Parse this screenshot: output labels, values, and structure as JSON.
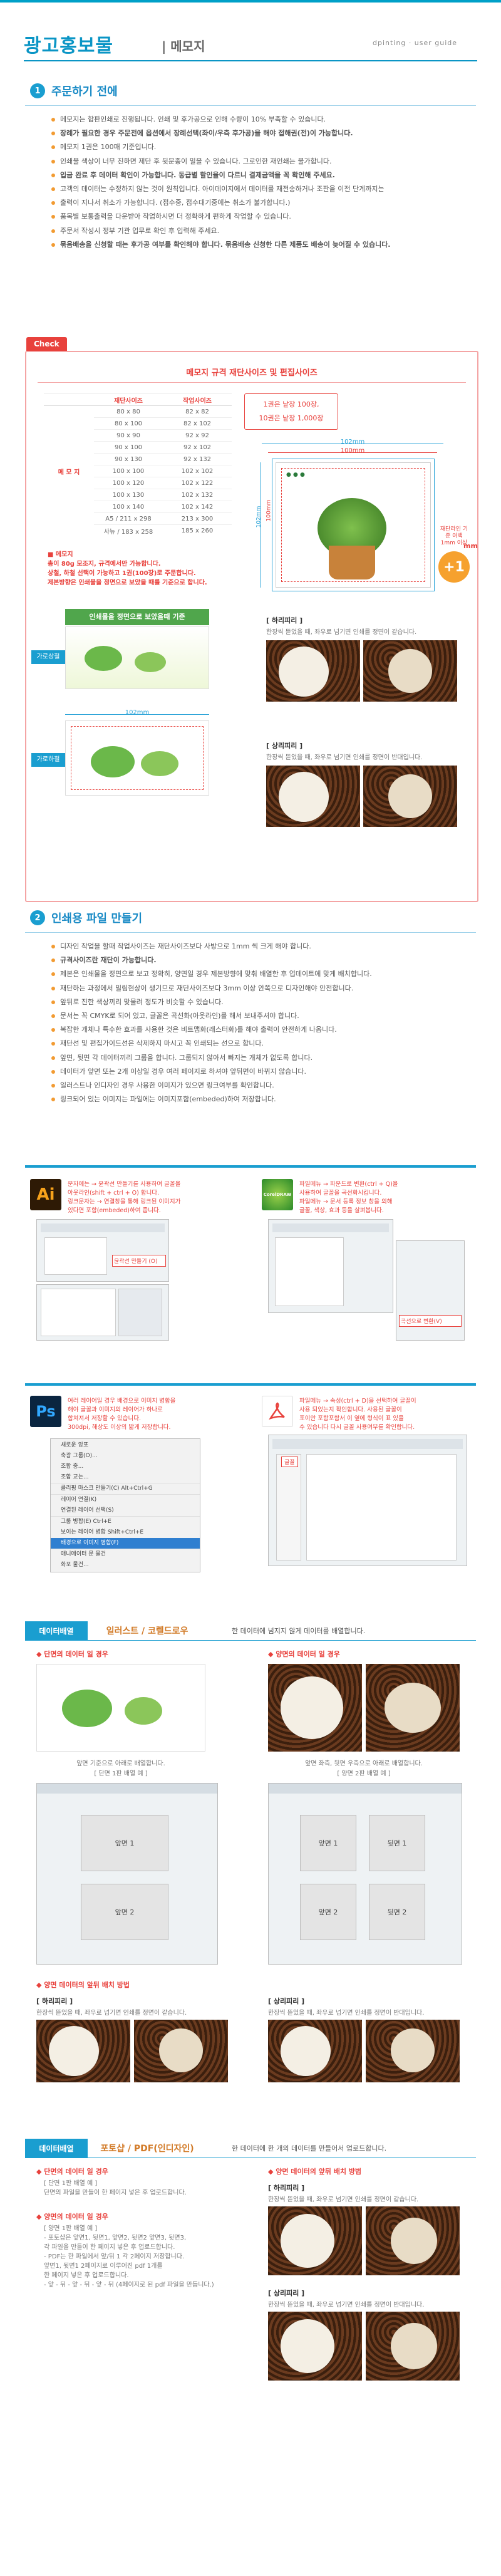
{
  "header": {
    "title": "광고홍보물",
    "subtitle": "| 메모지",
    "brand": "dpinting · user guide"
  },
  "section1": {
    "number": "1",
    "title": "주문하기 전에",
    "bullets": [
      "메모지는 합판인쇄로 진행됩니다. 인쇄 및 후가공으로 인해 수량이 10% 부족할 수 있습니다.",
      "장례가 필요한 경우 주문전에 옵션에서 장례선택(좌이/우측 후가공)을 해야 접해권(전)이 가능합니다.",
      "메모지 1권은 100매 기준입니다.",
      "인쇄물 색상이 너무 진하면 제단 후 뒷문종이 밀을 수 있습니다. 그로인한 재인쇄는 불가합니다.",
      "입금 완료 후 데이터 확인이 가능합니다. 동급별 할인율이 다르니 결제금액을 꼭 확인해 주세요.",
      "고객의 데이터는 수정하지 않는 것이 원칙입니다. 아이데이지에서 데이터를 재전송하거나 조판을 이전 단계까지는",
      "출력이 지나서 취소가 가능합니다. (접수중, 접수대기중에는 취소가 불가합니다.)",
      "품목별 보통출력을 다운받아 작업하시면 더 정확하게 편하게 작업할 수 있습니다.",
      "주문서 작성시 정부 기관 업무로 확인 후 입력해 주세요.",
      "묶음배송을 신청할 때는 후가공 여부를 확인해야 합니다. 묶음배송 신청한 다른 제품도 배송이 늦어질 수 있습니다."
    ]
  },
  "check_box": {
    "tab": "Check",
    "heading": "메모지 규격 재단사이즈 및 편집사이즈",
    "table": {
      "headers": [
        "",
        "재단사이즈",
        "작업사이즈"
      ],
      "product": "메 모 지",
      "rows": [
        [
          "80 x 80",
          "82 x 82"
        ],
        [
          "80 x 100",
          "82 x 102"
        ],
        [
          "90 x 90",
          "92 x 92"
        ],
        [
          "90 x 100",
          "92 x 102"
        ],
        [
          "90 x 130",
          "92 x 132"
        ],
        [
          "100 x 100",
          "102 x 102"
        ],
        [
          "100 x 120",
          "102 x 122"
        ],
        [
          "100 x 130",
          "102 x 132"
        ],
        [
          "100 x 140",
          "102 x 142"
        ],
        [
          "A5 / 211 x 298",
          "213 x 300"
        ],
        [
          "사뉴 / 183 x 258",
          "185 x 260"
        ]
      ]
    },
    "qty_lines": [
      "1권은 낱장 100장,",
      "10권은 낱장 1,000장"
    ],
    "dim_top_outer": "102mm",
    "dim_top_inner": "100mm",
    "dim_side_outer": "102mm",
    "dim_side_inner": "100mm",
    "bleed_note": "재단라인 기준 여백 1mm 이상",
    "plus_one": "+1",
    "mm": "mm",
    "memo_note_title": "■ 메모지",
    "memo_note_lines": [
      "총이 80g 모조지, 규격에서만 가능합니다.",
      "상철, 하철 선택이 가능하고 1권(100장)로 주문합니다.",
      "제본방향은 인쇄물을 정면으로 보았을 때를 기준으로 합니다."
    ],
    "green_bar": "인쇄물을 정면으로 보았을때 기준",
    "tag_vertical": "가로상철",
    "tag_horizontal": "가로하철",
    "dim_card_top": "102mm",
    "dim_card_top2": "100mm",
    "left_label": "[ 하리피리 ]",
    "left_text": "한장씩 뜯었을 때, 좌우로 넘기면 인쇄를 정면이 같습니다.",
    "right_label": "[ 상리피리 ]",
    "right_text": "한장씩 뜯었을 때, 좌우로 넘기면 인쇄를 정면이 반대입니다."
  },
  "section2": {
    "number": "2",
    "title": "인쇄용 파일 만들기",
    "bullets": [
      "디자인 작업을 할때 작업사이즈는 재단사이즈보다 사방으로 1mm 씩 크게 해야 합니다.",
      "규격사이즈란 재단이 가능합니다.",
      "제본은 인쇄물을 정면으로 보고 정확히, 양면일 경우 제본방향에 맞춰 배열한 후 업데이트에 맞게 배치합니다.",
      "재단하는 과정에서 밀림현상이 생기므로 재단사이즈보다 3mm 이상 안쪽으로 디자인해야 안전합니다.",
      "앞뒤로 진한 색상끼리 맞물려 정도가 비슷할 수 있습니다.",
      "문서는 꼭 CMYK로 되어 있고, 글꼴은 곡선화(아웃라인)를 해서 보내주셔야 합니다.",
      "복잡한 개체나 특수한 효과를 사용한 것은 비트맵화(래스터화)를 해야 출력이 안전하게 나옵니다.",
      "재단선 및 편집가이드선은 삭제하지 마시고 꼭 인쇄되는 선으로 합니다.",
      "앞면, 뒷면 각 데이터끼리 그룹을 합니다. 그룹되지 않아서 빠지는 개체가 없도록 합니다.",
      "데이터가 앞면 또는 2개 이상일 경우 여러 페이지로 하셔야 앞뒤면이 바뀌지 않습니다.",
      "일러스트나 인디자인 경우 사용한 이미지가 있으면 링크여부를 확인합니다.",
      "링크되어 있는 이미지는 파일에는 이미지포함(embeded)하여 저장합니다."
    ]
  },
  "software": {
    "ai_lines": [
      "문자에는 → 윤곽선 만들기를 사용하여 글꼴을",
      "아웃라인(shift + ctrl + O) 합니다.",
      "링크문자는 → 연결창을 통해 링크된 이미지가",
      "있다면 포함(embeded)하여 줍니다."
    ],
    "ai_badge": "Ai",
    "cd_badge": "CorelDRAW",
    "cd_lines": [
      "파일메뉴 → 파운드로 변환(ctrl + Q)을",
      "사용하여 글꼴을 곡선화시킵니다.",
      "파일메뉴 → 문서 등록 정보 창을 의해",
      "글꼴, 색상, 효과 등을 살펴봅니다."
    ],
    "ai_menu_hint": "윤곽선 만들기 (O)",
    "cd_menu_hint": "곡선으로 변환(V)",
    "ps_badge": "Ps",
    "ps_lines": [
      "여러 레이어일 경우 배경으로 이미지 병합을",
      "해야 글꼴과 이미지의 레이어가 하나로",
      "합쳐져서 저장할 수 있습니다.",
      "300dpi, 해상도 이상의 밟게 저장합니다."
    ],
    "pdf_lines": [
      "파일메뉴 → 속성(ctrl + D)을 선택하여 글꼴이",
      "사용 되었는지 확인합니다. 사용된 글꼴이",
      "포이안 포함포함서 이 옆에 형식이 표 있을",
      "수 있습니다 다시 글꼴 사용여부를 확인합니다."
    ],
    "ps_menu": [
      "새로운 앙포",
      "축광 그룹(O)...",
      "조합 중...",
      "조합 교는...",
      "클리핑 마스크 만들기(C)  Alt+Ctrl+G",
      "레이어 연결(K)",
      "연결된 레이어 선택(S)",
      "그룹 병합(E)  Ctrl+E",
      "보이는 레이어 병합  Shift+Ctrl+E",
      "배경으로 이미지 병합(F)",
      "애니메이터 문 물건",
      "화포 물건..."
    ],
    "ps_highlight": "배경으로 이미지 병합(F)",
    "pdf_hint": "글꼴"
  },
  "data_band1": {
    "left": "데이터배열",
    "mid": "일러스트 / 코렐드로우",
    "right": "한 데이터에 넘지지 않게 데이터를 배열합니다.",
    "a_title": "◆ 단면의 데이터 일 경우",
    "b_title": "◆ 양면의 데이터 일 경우",
    "a_cap1": "앞면 기준으로 아래로 배열합니다.",
    "a_cap2": "[ 단면 1판 배열 예 ]",
    "b_cap1": "앞면 좌측, 뒷면 우측으로 아래로 배열합니다.",
    "b_cap2": "[ 양면 2판 배열 예 ]",
    "a_page": "앞면 1",
    "a_page2": "앞면 2",
    "b_front": "앞면 1",
    "b_back": "뒷면 1",
    "b_front2": "앞면 2",
    "b_back2": "뒷면 2",
    "c_title": "◆ 양면 데이터의 앞뒤 배치 방법",
    "c_left_label": "[ 하리피리 ]",
    "c_left_text": "한장씩 뜯었을 때, 좌우로 넘기면 인쇄를 정면이 같습니다.",
    "c_right_label": "[ 상리피리 ]",
    "c_right_text": "한장씩 뜯었을 때, 좌우로 넘기면 인쇄를 정면이 반대입니다."
  },
  "data_band2": {
    "left": "데이터배열",
    "mid": "포토샵 / PDF(인디자인)",
    "right": "한 데이터에 한 개의 데이터를 만들어서 업로드합니다.",
    "a_title": "◆ 단면의 데이터 일 경우",
    "a_lines": [
      "[ 단면 1판 배열 예 ]",
      "단면의 파일을 만들이 한 페이지 넣은 후 업로드합니다."
    ],
    "b_title": "◆ 양면의 데이터 일 경우",
    "b_lines": [
      "[ 양면 1판 배열 예 ]",
      "- 포토샵은 앞면1, 뒷면1, 앞면2, 뒷면2 앞면3, 뒷면3,",
      "  각 파일을 만들이 한 페이지 넣은 후 업로드합니다.",
      "- PDF는 한 파일에서 앞/뒤 1 각 2페이지 저장합니다.",
      "  앞면1, 뒷면1 2페이지로 이루어진 pdf 1개를",
      "  한 페이지 넣은 후 업로드합니다.",
      "- 앞 - 뒤 - 앞 - 뒤 - 앞 - 뒤 (4페이지로 된 pdf 파일을 만듭니다.)"
    ],
    "c_title": "◆ 양면 데이터의 앞뒤 배치 방법",
    "c_left_label": "[ 하리피리 ]",
    "c_left_text": "한장씩 뜯었을 때, 좌우로 넘기면 인쇄를 정면이 같습니다.",
    "c_right_label": "[ 상리피리 ]",
    "c_right_text": "한장씩 뜯었을 때, 좌우로 넘기면 인쇄를 정면이 반대입니다."
  }
}
